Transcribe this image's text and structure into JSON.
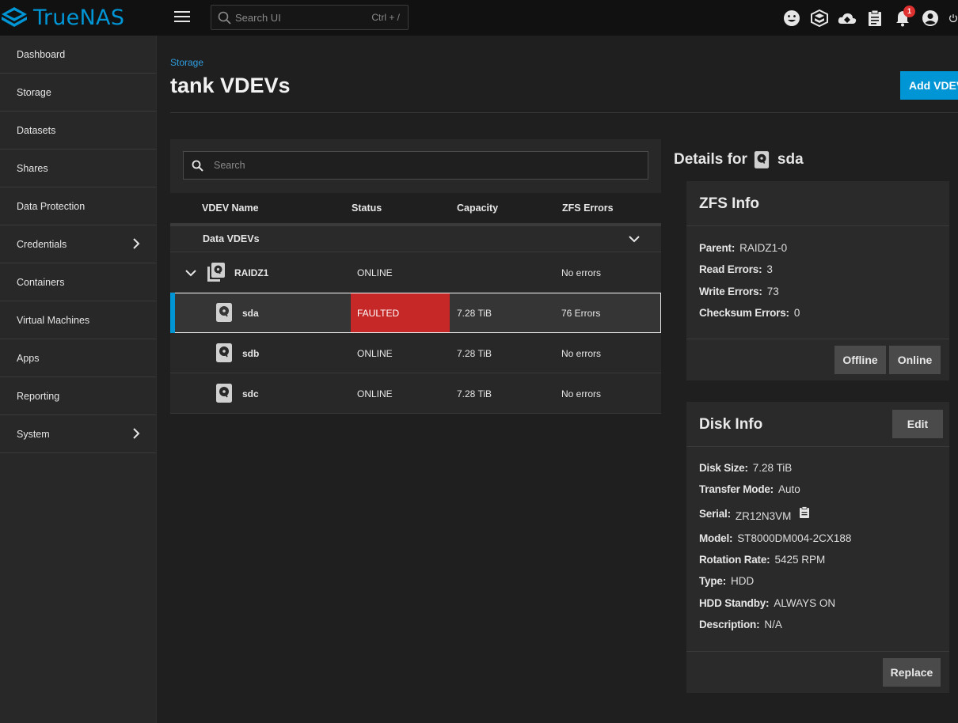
{
  "brand": {
    "name": "TrueNAS",
    "color": "#0095d5"
  },
  "topbar": {
    "search_placeholder": "Search UI",
    "shortcut": "Ctrl + /",
    "icons": [
      "feedback-icon",
      "truecommand-icon",
      "cloud-sync-icon",
      "tasks-icon",
      "notifications-icon",
      "account-icon",
      "power-icon"
    ],
    "notification_count": "1"
  },
  "sidebar": {
    "items": [
      {
        "label": "Dashboard",
        "has_children": false
      },
      {
        "label": "Storage",
        "has_children": false
      },
      {
        "label": "Datasets",
        "has_children": false
      },
      {
        "label": "Shares",
        "has_children": false
      },
      {
        "label": "Data Protection",
        "has_children": false
      },
      {
        "label": "Credentials",
        "has_children": true
      },
      {
        "label": "Containers",
        "has_children": false
      },
      {
        "label": "Virtual Machines",
        "has_children": false
      },
      {
        "label": "Apps",
        "has_children": false
      },
      {
        "label": "Reporting",
        "has_children": false
      },
      {
        "label": "System",
        "has_children": true
      }
    ]
  },
  "page": {
    "breadcrumb": "Storage",
    "title": "tank VDEVs",
    "add_button": "Add VDEV"
  },
  "table": {
    "search_placeholder": "Search",
    "columns": [
      "VDEV Name",
      "Status",
      "Capacity",
      "ZFS Errors"
    ],
    "group_label": "Data VDEVs",
    "vdev": {
      "name": "RAIDZ1",
      "status": "ONLINE",
      "errors": "No errors"
    },
    "disks": [
      {
        "name": "sda",
        "status": "FAULTED",
        "capacity": "7.28 TiB",
        "errors": "76 Errors",
        "selected": true
      },
      {
        "name": "sdb",
        "status": "ONLINE",
        "capacity": "7.28 TiB",
        "errors": "No errors",
        "selected": false
      },
      {
        "name": "sdc",
        "status": "ONLINE",
        "capacity": "7.28 TiB",
        "errors": "No errors",
        "selected": false
      }
    ],
    "faulted_color": "#c62828"
  },
  "details": {
    "prefix": "Details for",
    "disk": "sda",
    "zfs_info": {
      "title": "ZFS Info",
      "parent_label": "Parent:",
      "parent": "RAIDZ1-0",
      "read_label": "Read Errors:",
      "read": "3",
      "write_label": "Write Errors:",
      "write": "73",
      "checksum_label": "Checksum Errors:",
      "checksum": "0",
      "offline_button": "Offline",
      "online_button": "Online"
    },
    "disk_info": {
      "title": "Disk Info",
      "edit_button": "Edit",
      "size_label": "Disk Size:",
      "size": "7.28 TiB",
      "transfer_label": "Transfer Mode:",
      "transfer": "Auto",
      "serial_label": "Serial:",
      "serial": "ZR12N3VM",
      "model_label": "Model:",
      "model": "ST8000DM004-2CX188",
      "rotation_label": "Rotation Rate:",
      "rotation": "5425 RPM",
      "type_label": "Type:",
      "type": "HDD",
      "standby_label": "HDD Standby:",
      "standby": "ALWAYS ON",
      "description_label": "Description:",
      "description": "N/A",
      "replace_button": "Replace"
    }
  }
}
